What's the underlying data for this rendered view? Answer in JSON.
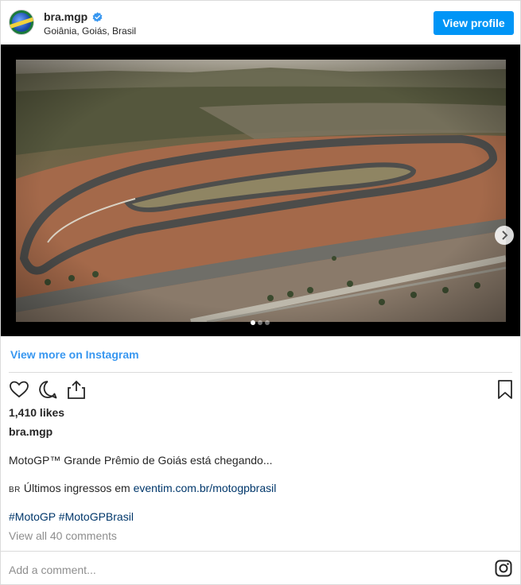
{
  "header": {
    "username": "bra.mgp",
    "location": "Goiânia, Goiás, Brasil",
    "view_profile_label": "View profile"
  },
  "media": {
    "carousel_count": 3,
    "carousel_active": 1
  },
  "view_more_label": "View more on Instagram",
  "actions": {
    "icons": [
      "heart-icon",
      "comment-icon",
      "share-icon",
      "bookmark-icon"
    ]
  },
  "likes_text": "1,410 likes",
  "owner": "bra.mgp",
  "caption": {
    "line1": "MotoGP™ Grande Prêmio de Goiás está chegando...",
    "line2_prefix": "Últimos ingressos em ",
    "line2_flag": "BR",
    "line2_link": "eventim.com.br/motogpbrasil",
    "hashtag1": "#MotoGP",
    "hashtag2": "#MotoGPBrasil"
  },
  "view_comments": "View all 40 comments",
  "add_comment_placeholder": "Add a comment...",
  "colors": {
    "accent": "#0095f6",
    "link": "#3897f0",
    "hashtag": "#00376b",
    "muted": "#8e8e8e",
    "border": "#dbdbdb"
  }
}
